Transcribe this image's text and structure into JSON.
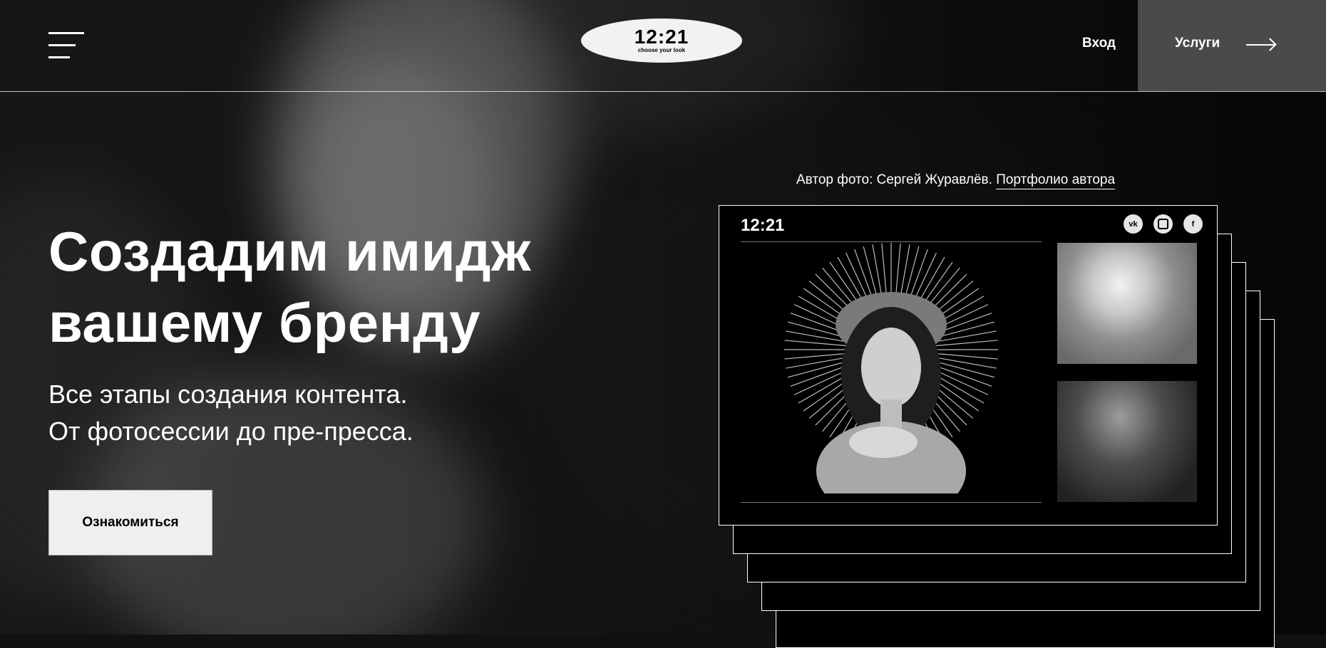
{
  "header": {
    "logo_main": "12:21",
    "logo_sub": "choose your look",
    "login_label": "Вход",
    "services_label": "Услуги"
  },
  "hero": {
    "title_line1": "Создадим имидж",
    "title_line2": "вашему бренду",
    "subtitle_line1": "Все этапы создания контента.",
    "subtitle_line2": "От фотосессии до пре-пресса.",
    "cta_label": "Ознакомиться"
  },
  "credit": {
    "text": "Автор фото: Сергей Журавлёв.",
    "link_label": "Портфолио автора"
  },
  "showcase": {
    "logo": "12:21",
    "socials": [
      {
        "name": "vk-icon",
        "glyph": "vk"
      },
      {
        "name": "instagram-icon",
        "glyph": ""
      },
      {
        "name": "facebook-icon",
        "glyph": "f"
      }
    ]
  },
  "colors": {
    "background": "#111111",
    "services_bg": "#4a4a4a",
    "cta_bg": "#efefef",
    "accent": "#ffffff"
  },
  "icons": [
    "menu-icon",
    "arrow-right-icon",
    "vk-icon",
    "instagram-icon",
    "facebook-icon"
  ]
}
